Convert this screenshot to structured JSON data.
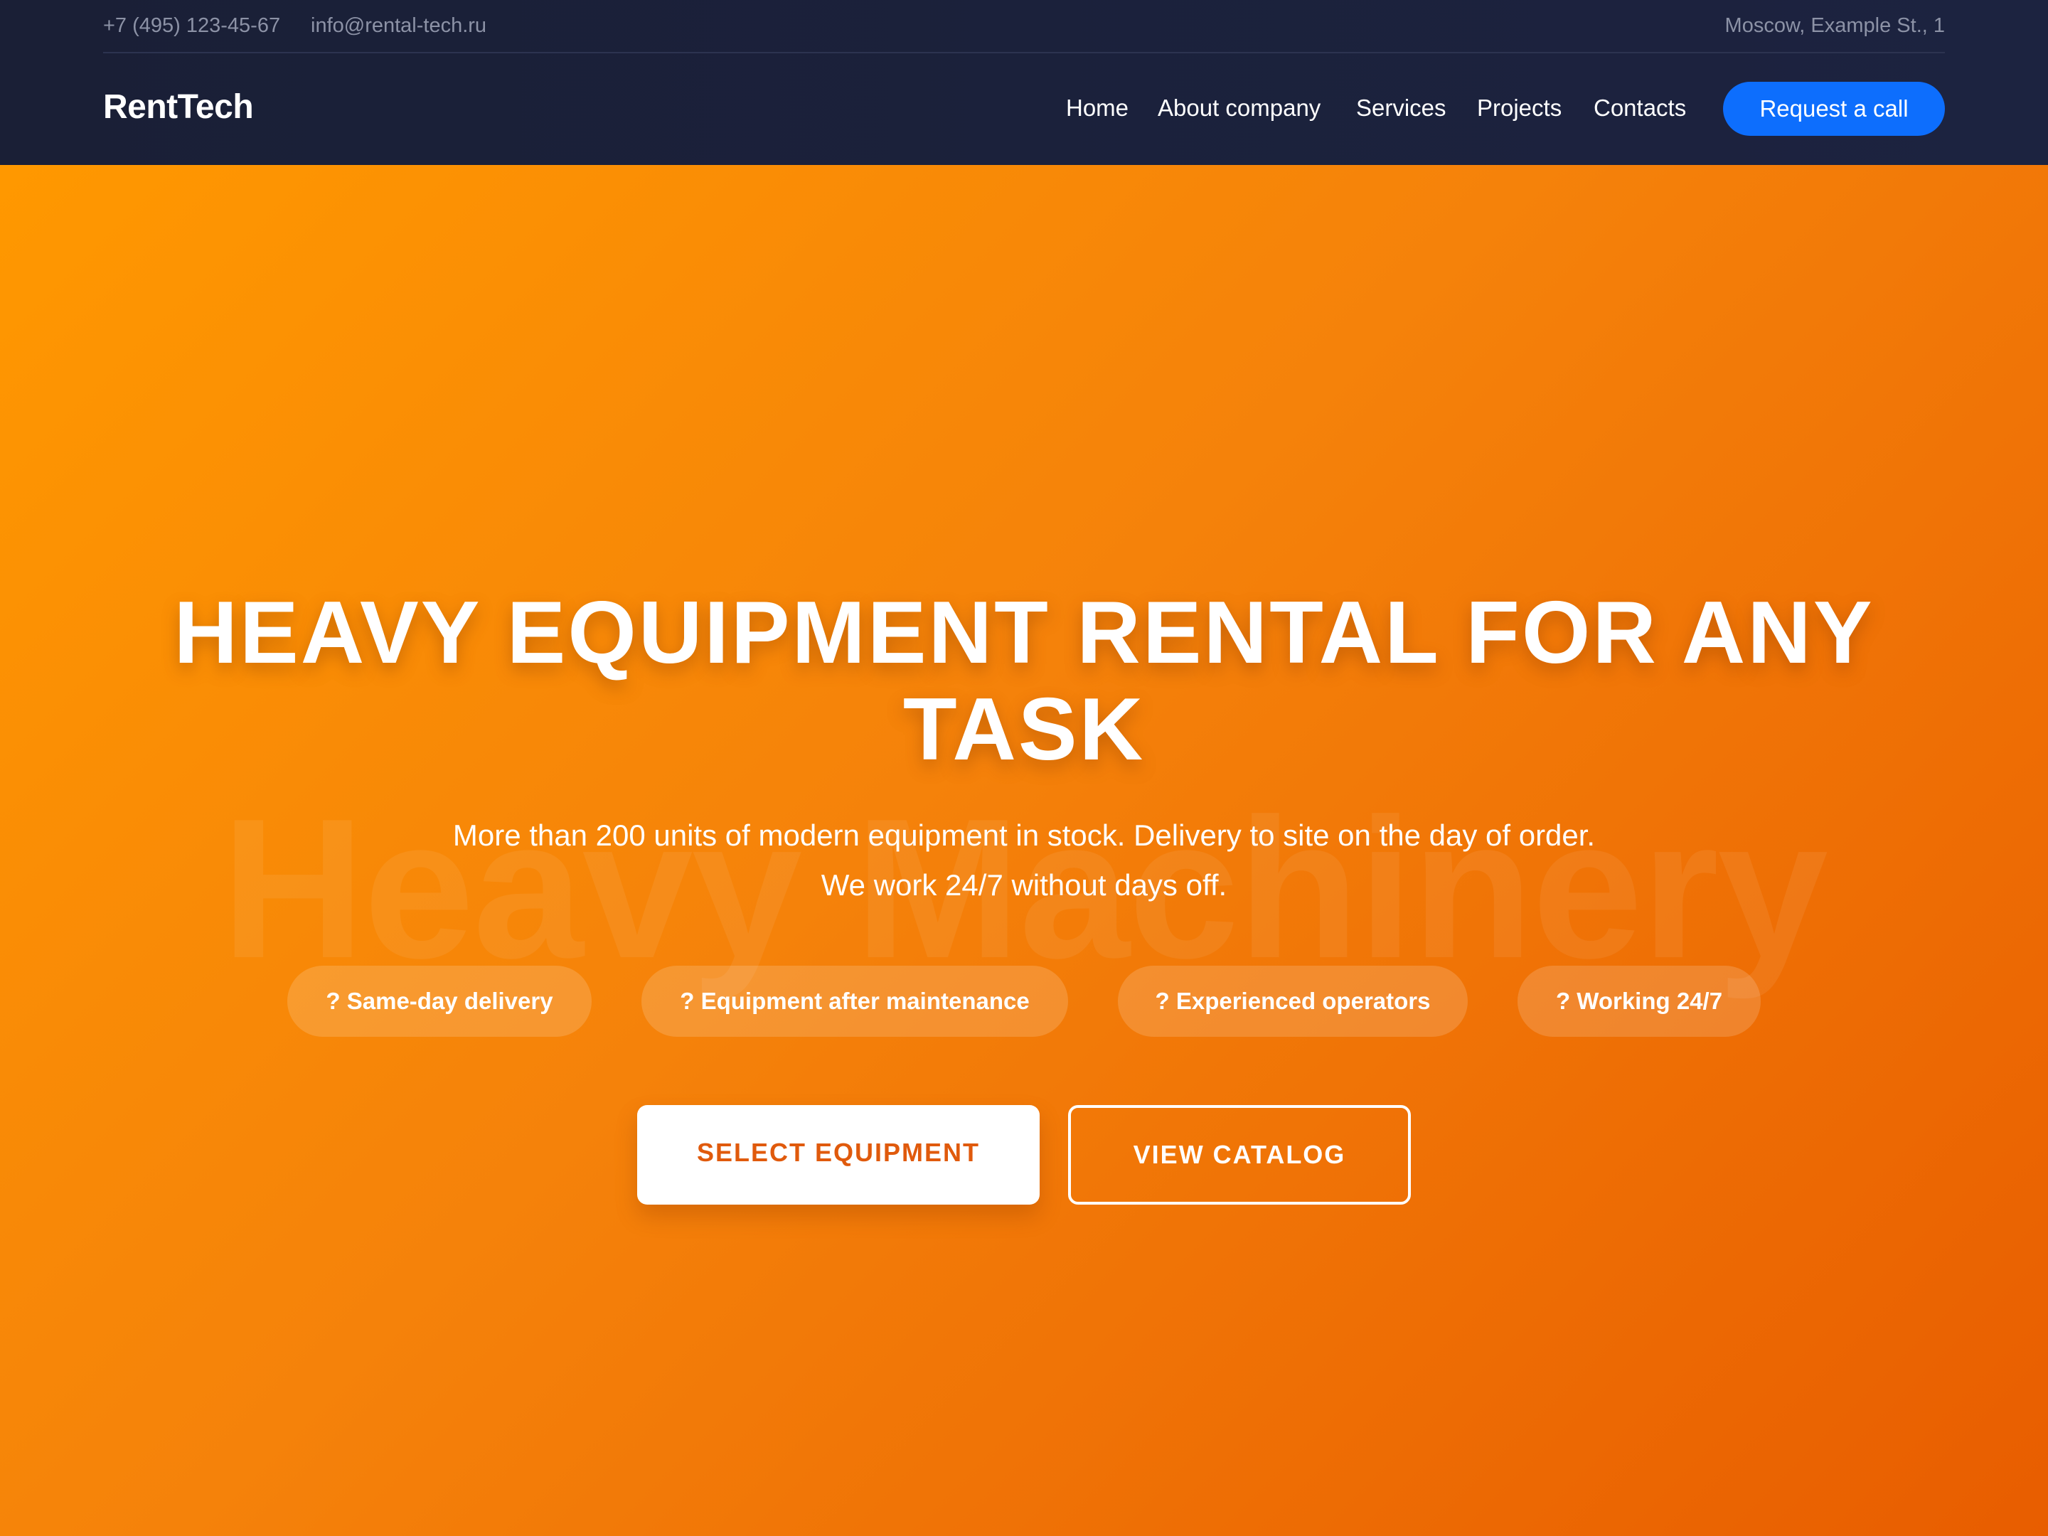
{
  "topbar": {
    "phone": "+7 (495) 123-45-67",
    "email": "info@rental-tech.ru",
    "address": "Moscow, Example St., 1"
  },
  "navbar": {
    "logo": "RentTech",
    "links": [
      "Home",
      "About company",
      "Services",
      "Projects",
      "Contacts"
    ],
    "cta_label": "Request a call"
  },
  "hero": {
    "watermark": "Heavy Machinery",
    "title": "HEAVY EQUIPMENT RENTAL FOR ANY TASK",
    "subtitle": "More than 200 units of modern equipment in stock. Delivery to site on the day of order. We work 24/7 without days off.",
    "features": [
      "? Same-day delivery",
      "? Equipment after maintenance",
      "? Experienced operators",
      "? Working 24/7"
    ],
    "primary_button": "SELECT EQUIPMENT",
    "secondary_button": "VIEW CATALOG"
  },
  "colors": {
    "header_bg": "#1a1f36",
    "accent_blue": "#0d6efd",
    "hero_orange_start": "#ff9800",
    "hero_orange_end": "#e85d00",
    "primary_button_text": "#e05a0c"
  }
}
